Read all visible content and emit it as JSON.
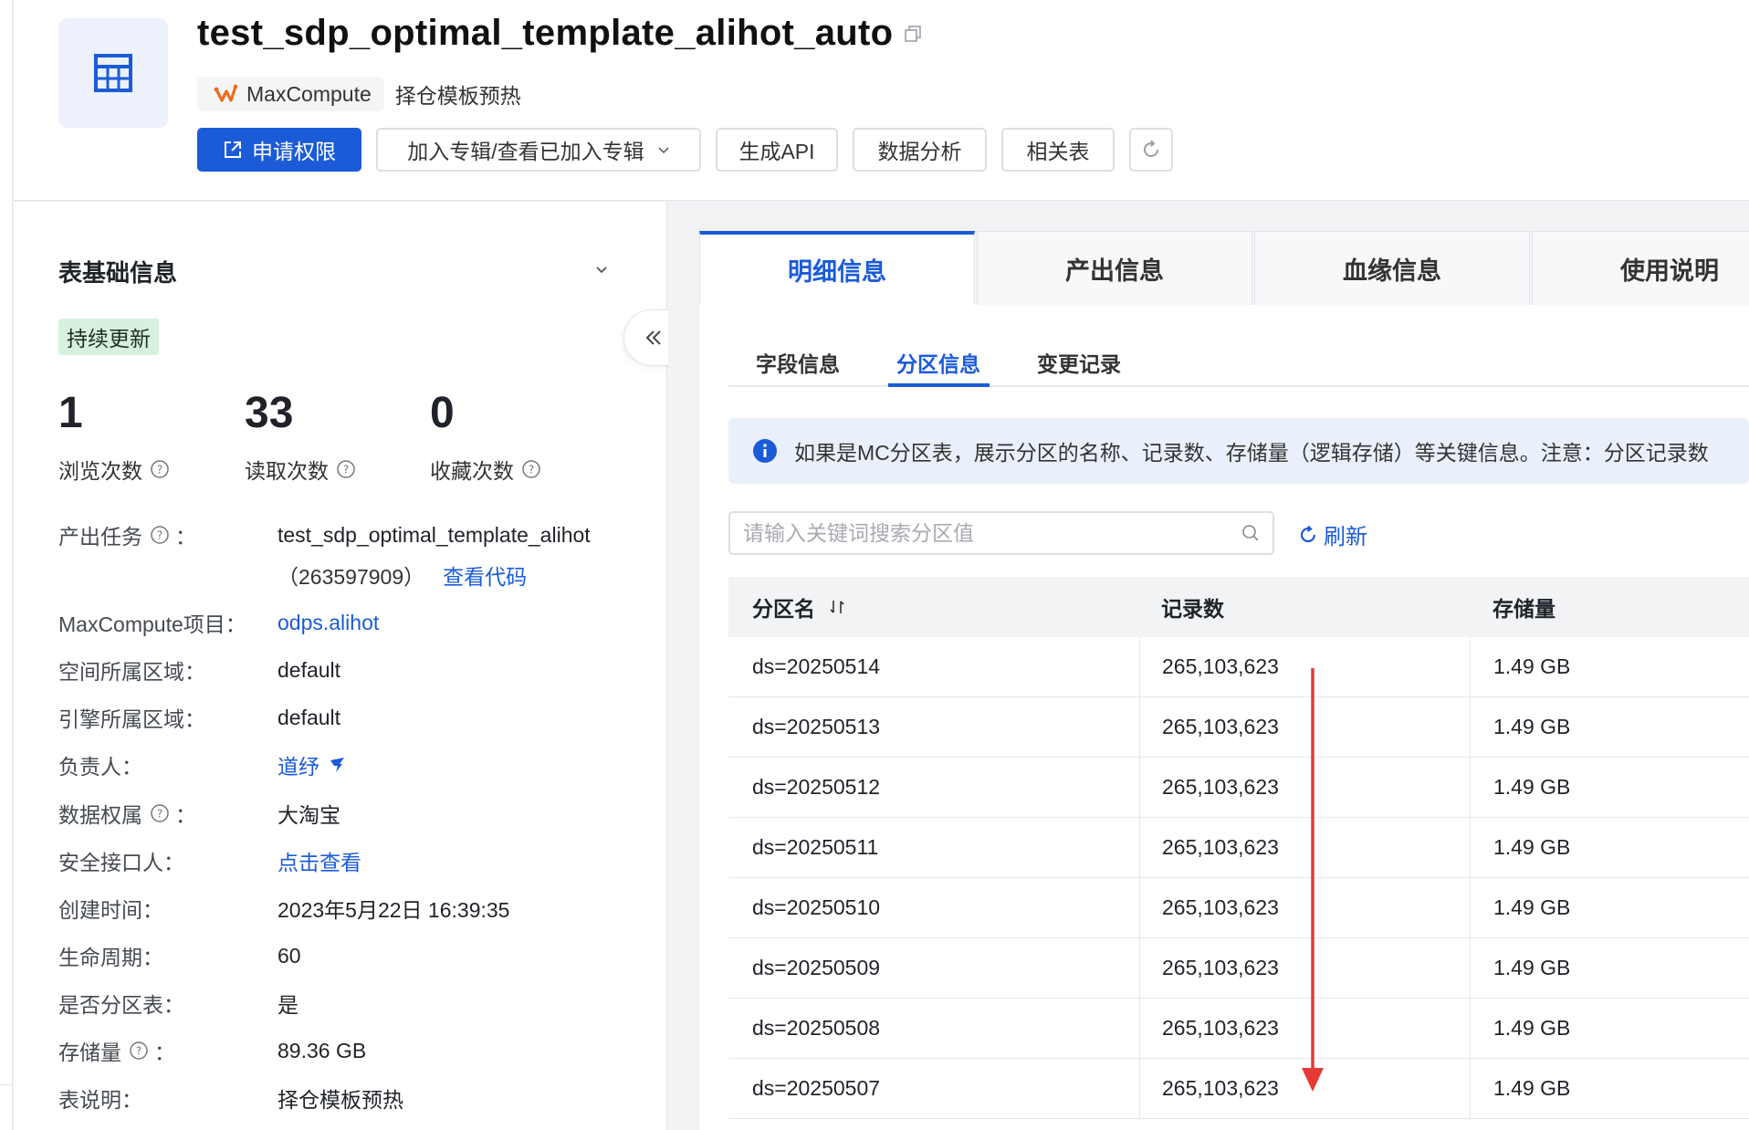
{
  "header": {
    "title": "test_sdp_optimal_template_alihot_auto",
    "engine": "MaxCompute",
    "description": "择仓模板预热",
    "buttons": {
      "apply_permission": "申请权限",
      "add_album": "加入专辑/查看已加入专辑",
      "generate_api": "生成API",
      "data_analysis": "数据分析",
      "related_tables": "相关表"
    },
    "icons": {
      "table": "table-grid-icon",
      "copy": "copy-icon",
      "engine": "maxcompute-logo-icon",
      "refresh": "refresh-icon"
    }
  },
  "basic_info": {
    "section_title": "表基础信息",
    "status_badge": "持续更新",
    "stats": [
      {
        "value": "1",
        "label": "浏览次数"
      },
      {
        "value": "33",
        "label": "读取次数"
      },
      {
        "value": "0",
        "label": "收藏次数"
      }
    ],
    "fields": {
      "output_task_key": "产出任务",
      "output_task_value_line1": "test_sdp_optimal_template_alihot",
      "output_task_value_line2": "（263597909）",
      "view_code": "查看代码",
      "project_key": "MaxCompute项目：",
      "project_value": "odps.alihot",
      "space_region_key": "空间所属区域：",
      "space_region_value": "default",
      "engine_region_key": "引擎所属区域：",
      "engine_region_value": "default",
      "owner_key": "负责人：",
      "owner_value": "道纾",
      "data_owner_key": "数据权属",
      "data_owner_value": "大淘宝",
      "security_contact_key": "安全接口人：",
      "security_contact_value": "点击查看",
      "created_key": "创建时间：",
      "created_value": "2023年5月22日 16:39:35",
      "lifecycle_key": "生命周期：",
      "lifecycle_value": "60",
      "partitioned_key": "是否分区表：",
      "partitioned_value": "是",
      "storage_key": "存储量",
      "storage_value": "89.36 GB",
      "desc_key": "表说明：",
      "desc_value": "择仓模板预热",
      "colon": "："
    }
  },
  "tabs": [
    "明细信息",
    "产出信息",
    "血缘信息",
    "使用说明"
  ],
  "subtabs": [
    "字段信息",
    "分区信息",
    "变更记录"
  ],
  "notice": "如果是MC分区表，展示分区的名称、记录数、存储量（逻辑存储）等关键信息。注意：分区记录数",
  "search": {
    "placeholder": "请输入关键词搜索分区值",
    "value": ""
  },
  "refresh_label": "刷新",
  "partition_table": {
    "columns": [
      "分区名",
      "记录数",
      "存储量"
    ],
    "rows": [
      {
        "name": "ds=20250514",
        "records": "265,103,623",
        "size": "1.49 GB"
      },
      {
        "name": "ds=20250513",
        "records": "265,103,623",
        "size": "1.49 GB"
      },
      {
        "name": "ds=20250512",
        "records": "265,103,623",
        "size": "1.49 GB"
      },
      {
        "name": "ds=20250511",
        "records": "265,103,623",
        "size": "1.49 GB"
      },
      {
        "name": "ds=20250510",
        "records": "265,103,623",
        "size": "1.49 GB"
      },
      {
        "name": "ds=20250509",
        "records": "265,103,623",
        "size": "1.49 GB"
      },
      {
        "name": "ds=20250508",
        "records": "265,103,623",
        "size": "1.49 GB"
      },
      {
        "name": "ds=20250507",
        "records": "265,103,623",
        "size": "1.49 GB"
      }
    ]
  },
  "colors": {
    "primary": "#1b5bd8",
    "badge_bg": "#d8f1de",
    "annotation_arrow": "#e53935"
  }
}
